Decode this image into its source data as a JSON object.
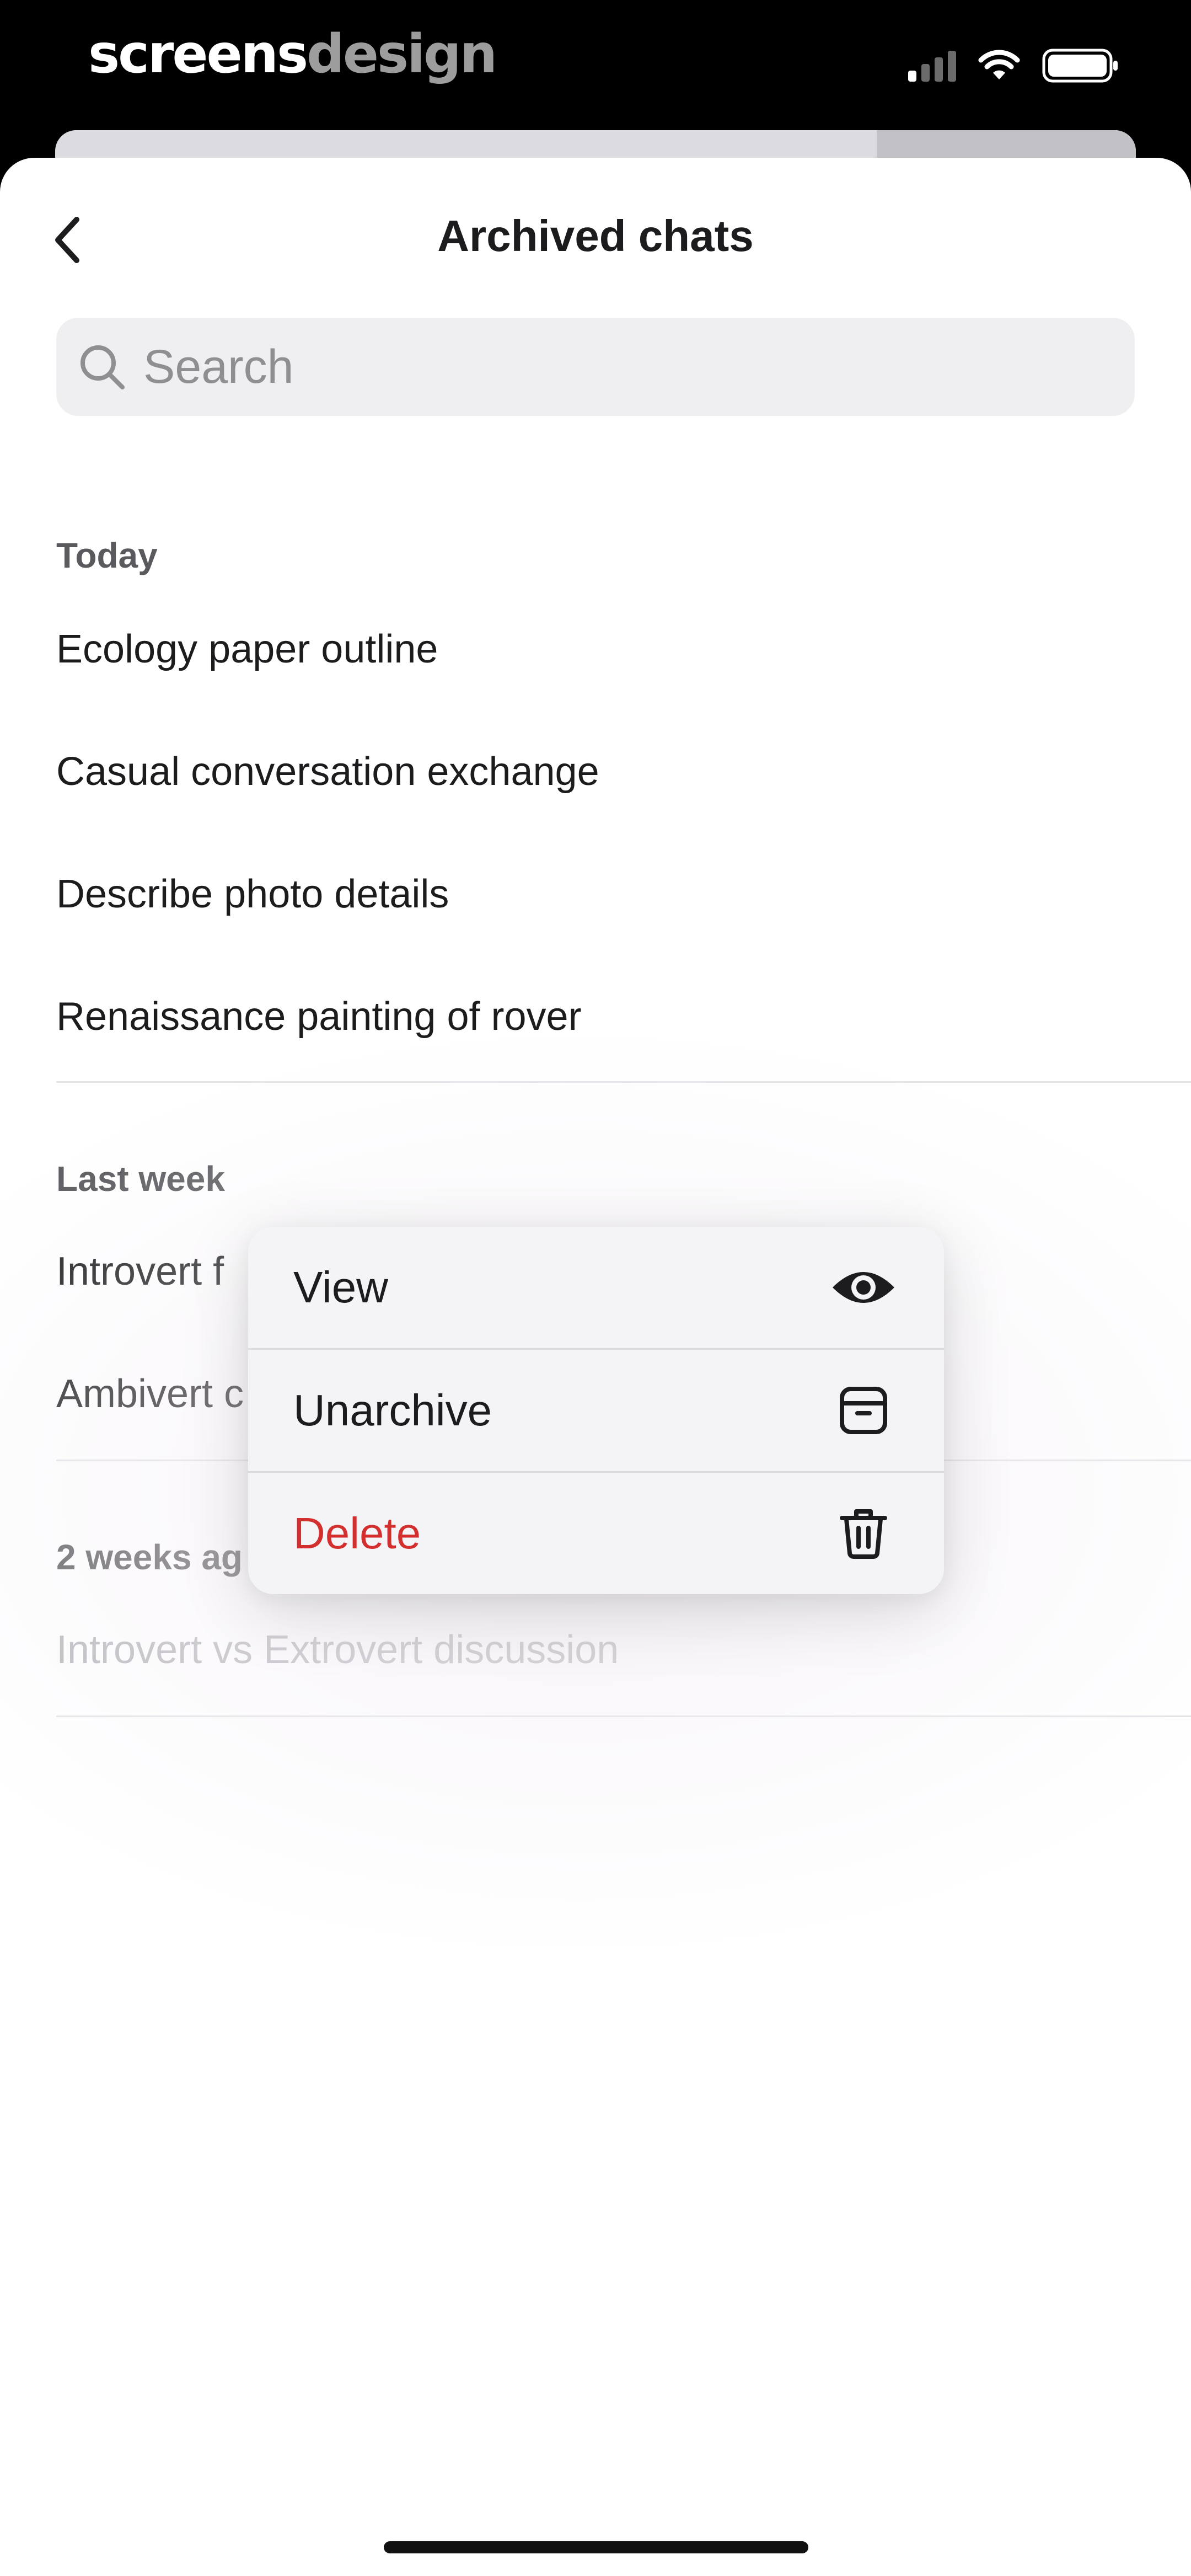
{
  "status_bar": {
    "brand_part1": "screens",
    "brand_part2": "design"
  },
  "header": {
    "title": "Archived chats"
  },
  "search": {
    "placeholder": "Search"
  },
  "sections": [
    {
      "header": "Today",
      "items": [
        "Ecology paper outline",
        "Casual conversation exchange",
        "Describe photo details",
        "Renaissance painting of rover"
      ]
    },
    {
      "header": "Last week",
      "items": [
        "Introvert f",
        "Ambivert c"
      ]
    },
    {
      "header": "2 weeks ag",
      "items": [
        "Introvert vs Extrovert discussion"
      ]
    }
  ],
  "context_menu": {
    "items": [
      {
        "label": "View",
        "icon": "eye-icon"
      },
      {
        "label": "Unarchive",
        "icon": "archive-box-icon"
      },
      {
        "label": "Delete",
        "icon": "trash-icon",
        "color": "#d32f2f"
      }
    ]
  }
}
